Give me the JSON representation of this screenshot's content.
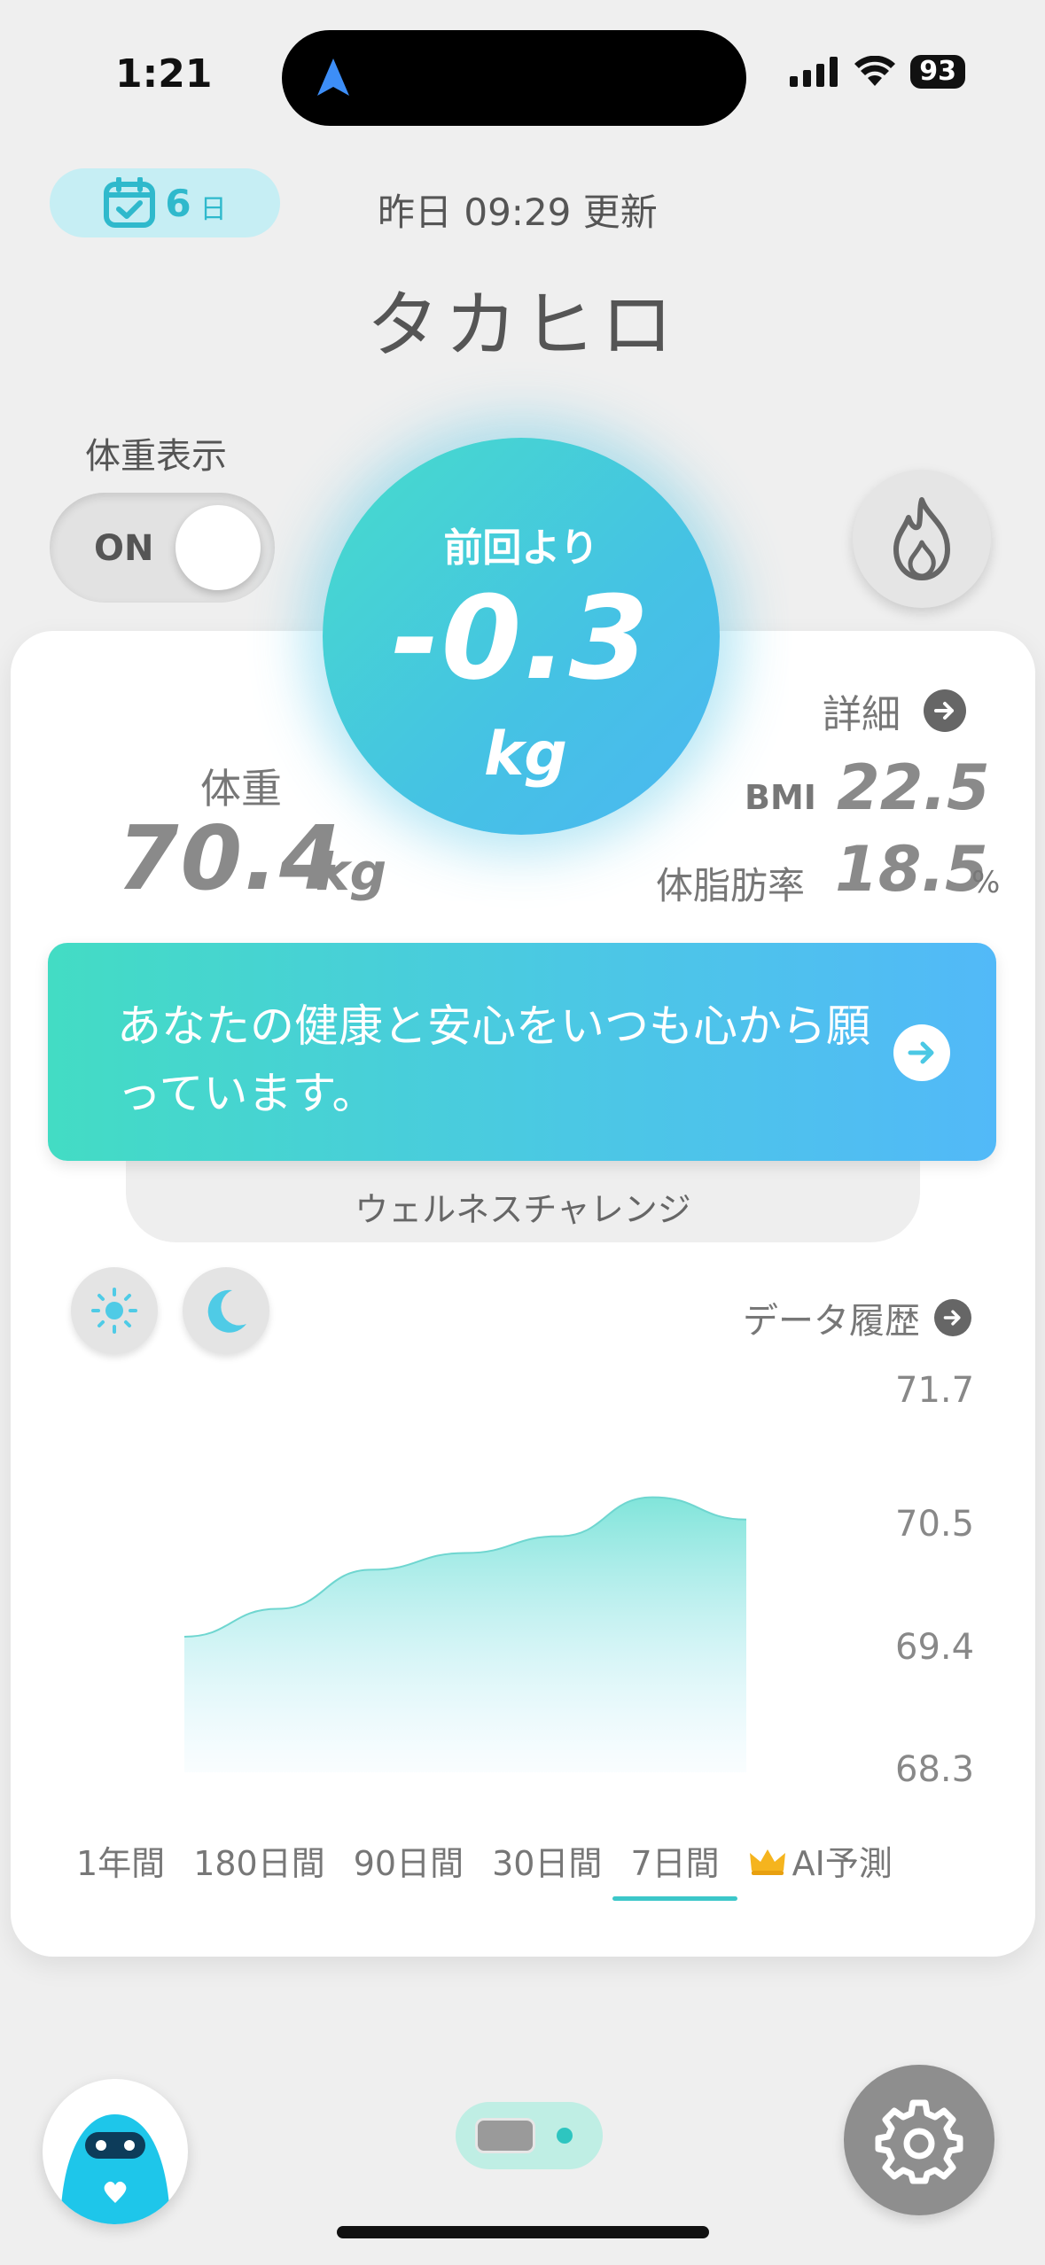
{
  "status_bar": {
    "time": "1:21",
    "battery": "93"
  },
  "header": {
    "days_count": "6",
    "days_unit": "日",
    "updated": "昨日 09:29 更新",
    "user_name": "タカヒロ"
  },
  "weight_toggle": {
    "label": "体重表示",
    "state": "ON"
  },
  "diff": {
    "label": "前回より",
    "value": "-0.3",
    "unit": "kg"
  },
  "weight": {
    "label": "体重",
    "value": "70.4",
    "unit": "kg"
  },
  "details": {
    "link_label": "詳細",
    "bmi_label": "BMI",
    "bmi_value": "22.5",
    "fat_label": "体脂肪率",
    "fat_value": "18.5",
    "fat_unit": "%"
  },
  "banner": {
    "message": "あなたの健康と安心をいつも心から願っています。"
  },
  "wellness_tab": "ウェルネスチャレンジ",
  "history_link": "データ履歴",
  "periods": [
    "1年間",
    "180日間",
    "90日間",
    "30日間",
    "7日間",
    "AI予測"
  ],
  "active_period": "7日間",
  "colors": {
    "accent": "#3cc7c9",
    "gradient_start": "#43dcc4",
    "gradient_end": "#52b9f8"
  },
  "chart_data": {
    "type": "area",
    "y_ticks": [
      "71.7",
      "70.5",
      "69.4",
      "68.3"
    ],
    "ylim": [
      68.3,
      71.7
    ],
    "x": [
      1,
      2,
      3,
      4,
      5,
      6,
      7
    ],
    "values": [
      69.5,
      69.75,
      70.1,
      70.25,
      70.4,
      70.75,
      70.55
    ],
    "grid": false,
    "legend": "none"
  }
}
